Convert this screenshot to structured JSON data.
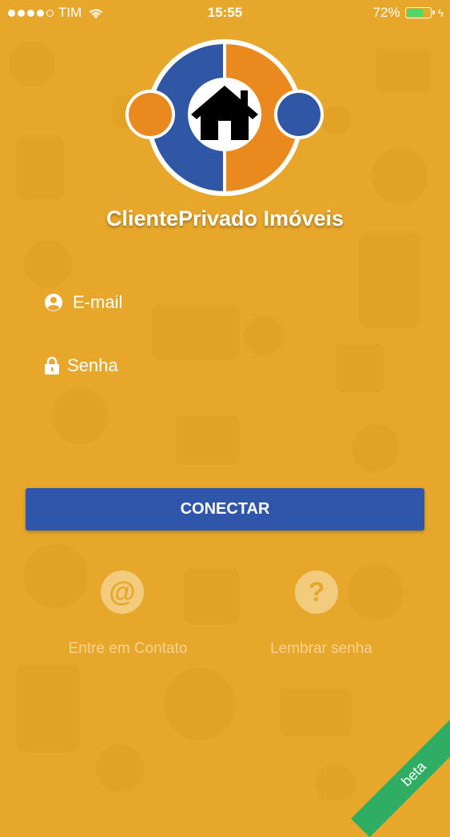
{
  "status_bar": {
    "signal_bars": 4,
    "signal_max": 5,
    "carrier": "TIM",
    "wifi_icon": "wifi-icon",
    "time": "15:55",
    "battery_percent": "72%",
    "battery_level": 0.72,
    "charging_icon": "bolt-icon"
  },
  "logo": {
    "left_color": "#2F57A6",
    "right_color": "#EA8A1E",
    "icon": "house-icon"
  },
  "brand": {
    "name": "ClientePrivado Imóveis"
  },
  "form": {
    "email_placeholder": "E-mail",
    "email_icon": "user-circle-icon",
    "password_placeholder": "Senha",
    "password_icon": "lock-icon"
  },
  "connect_button": {
    "label": "CONECTAR",
    "color": "#3056AB"
  },
  "actions": [
    {
      "label": "Entre em Contato",
      "icon": "at-sign-icon",
      "glyph": "@"
    },
    {
      "label": "Lembrar senha",
      "icon": "question-icon",
      "glyph": "?"
    }
  ],
  "ribbon": {
    "label": "beta",
    "color": "#2FAE63"
  },
  "background_color": "#E7A72A"
}
